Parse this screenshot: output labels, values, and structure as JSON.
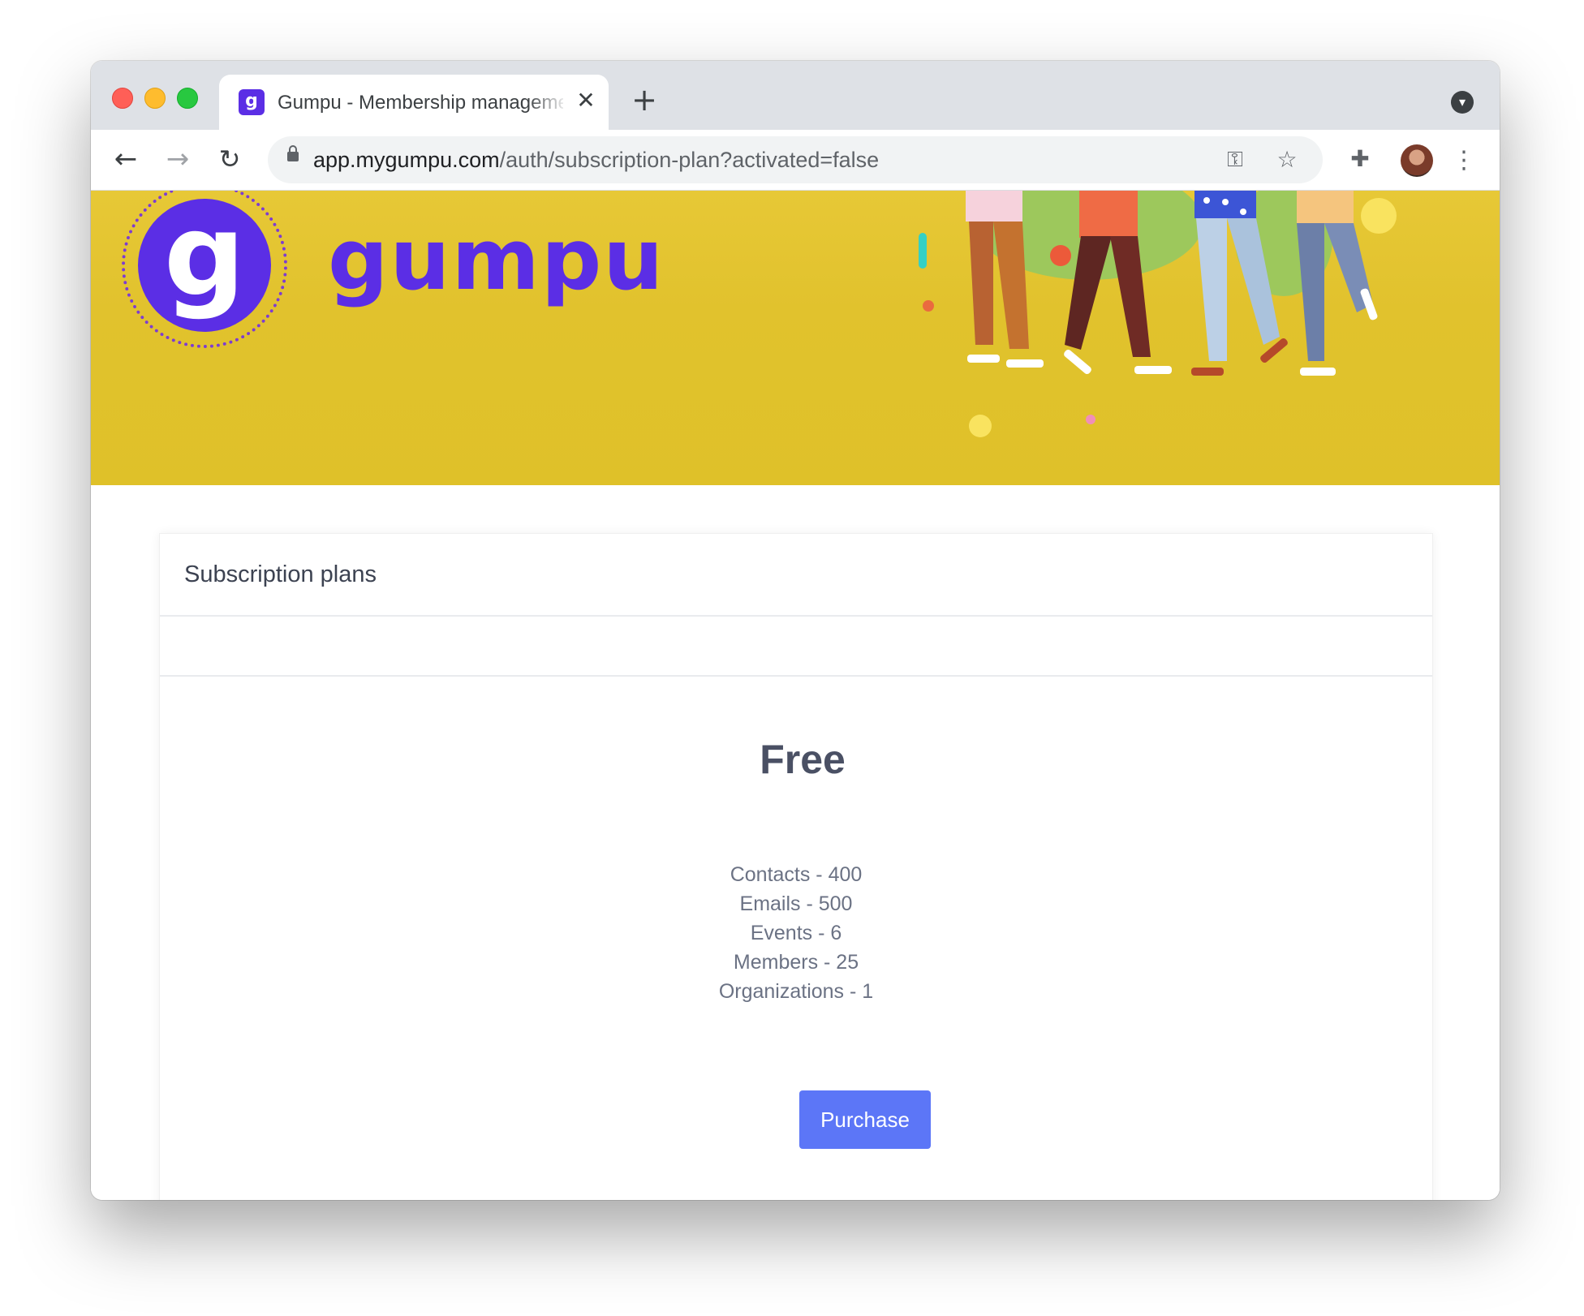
{
  "browser": {
    "tab_title": "Gumpu - Membership management",
    "favicon_letter": "g",
    "url_host": "app.mygumpu.com",
    "url_path": "/auth/subscription-plan?activated=false"
  },
  "banner": {
    "logo_letter": "g",
    "logo_word": "gumpu",
    "background_color": "#e1c22d",
    "brand_color": "#5b2ee5"
  },
  "card": {
    "title": "Subscription plans"
  },
  "plan": {
    "name": "Free",
    "features": [
      "Contacts - 400",
      "Emails - 500",
      "Events - 6",
      "Members - 25",
      "Organizations - 1"
    ],
    "button_label": "Purchase",
    "button_color": "#5c76f7"
  }
}
